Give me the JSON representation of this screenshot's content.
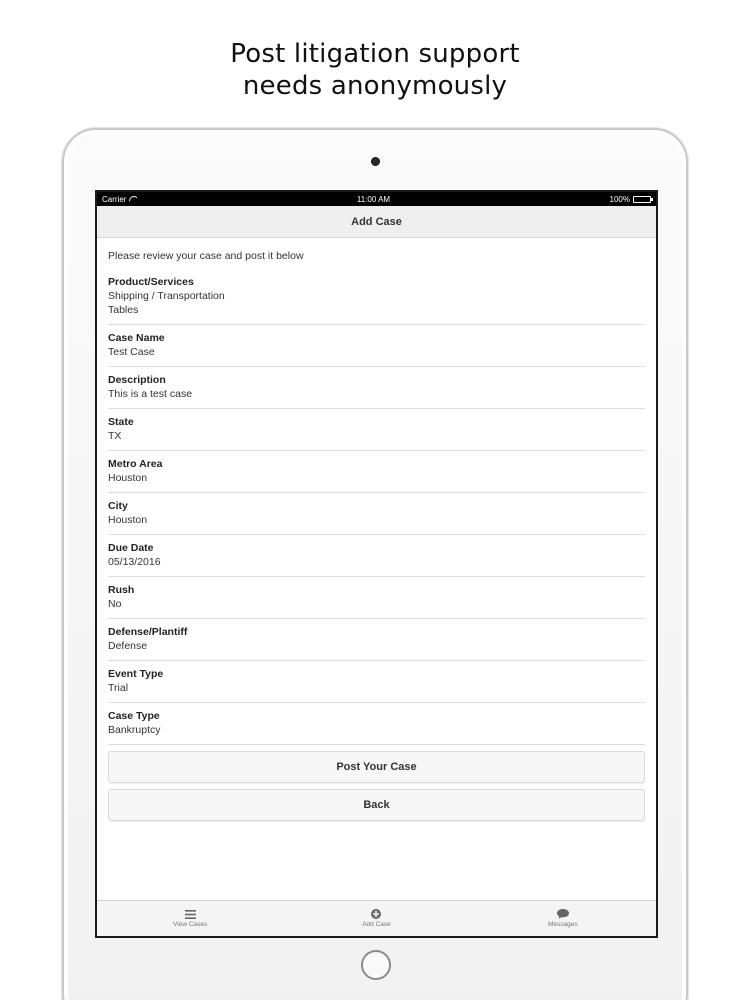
{
  "headline": {
    "line1": "Post litigation support",
    "line2": "needs anonymously"
  },
  "status_bar": {
    "carrier": "Carrier",
    "time": "11:00 AM",
    "battery": "100%"
  },
  "nav": {
    "title": "Add Case"
  },
  "intro": "Please review your case and post it below",
  "fields": [
    {
      "label": "Product/Services",
      "values": [
        "Shipping / Transportation",
        "Tables"
      ]
    },
    {
      "label": "Case Name",
      "values": [
        "Test Case"
      ]
    },
    {
      "label": "Description",
      "values": [
        "This is a test case"
      ]
    },
    {
      "label": "State",
      "values": [
        "TX"
      ]
    },
    {
      "label": "Metro Area",
      "values": [
        "Houston"
      ]
    },
    {
      "label": "City",
      "values": [
        "Houston"
      ]
    },
    {
      "label": "Due Date",
      "values": [
        "05/13/2016"
      ]
    },
    {
      "label": "Rush",
      "values": [
        "No"
      ]
    },
    {
      "label": "Defense/Plantiff",
      "values": [
        "Defense"
      ]
    },
    {
      "label": "Event Type",
      "values": [
        "Trial"
      ]
    },
    {
      "label": "Case Type",
      "values": [
        "Bankruptcy"
      ]
    }
  ],
  "buttons": {
    "post": "Post Your Case",
    "back": "Back"
  },
  "tabs": [
    {
      "label": "View Cases",
      "icon": "list-icon"
    },
    {
      "label": "Add Case",
      "icon": "plus-circle-icon"
    },
    {
      "label": "Messages",
      "icon": "chat-bubble-icon"
    }
  ]
}
